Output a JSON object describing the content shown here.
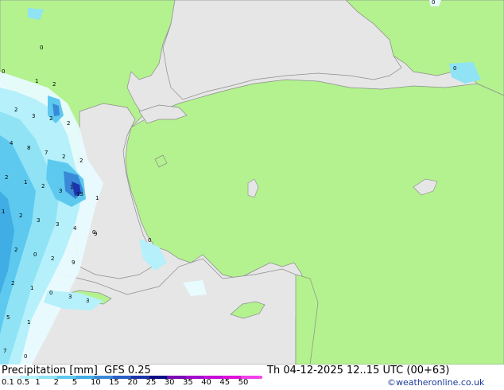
{
  "footer": {
    "title": "Precipitation [mm]",
    "model": "GFS 0.25",
    "valid_time": "Th 04-12-2025 12..15 UTC (00+63)",
    "credit": "©weatheronline.co.uk"
  },
  "legend": {
    "labels": [
      "0.1",
      "0.5",
      "1",
      "2",
      "5",
      "10",
      "15",
      "20",
      "25",
      "30",
      "35",
      "40",
      "45",
      "50"
    ],
    "colors": [
      "#e8fbff",
      "#b5f0fb",
      "#8fe3f5",
      "#5ec9ef",
      "#40aee4",
      "#3a89d8",
      "#2a5fc9",
      "#1c35ad",
      "#0c0b85",
      "#7a06b4",
      "#a308cc",
      "#c60ad8",
      "#e010d8",
      "#f040e8"
    ]
  },
  "map": {
    "land_color": "#b3f28f",
    "sea_color": "#e6e6e6",
    "values": [
      "1",
      "2",
      "0",
      "2",
      "3",
      "2",
      "2",
      "4",
      "8",
      "7",
      "2",
      "2",
      "2",
      "1",
      "2",
      "3",
      "1",
      "13",
      "1",
      "2",
      "1",
      "3",
      "3",
      "4",
      "0",
      "2",
      "0",
      "0",
      "2",
      "2",
      "1",
      "3",
      "3",
      "5",
      "1",
      "7",
      "0",
      "0",
      "9",
      "0",
      "9",
      "0",
      "0"
    ]
  }
}
